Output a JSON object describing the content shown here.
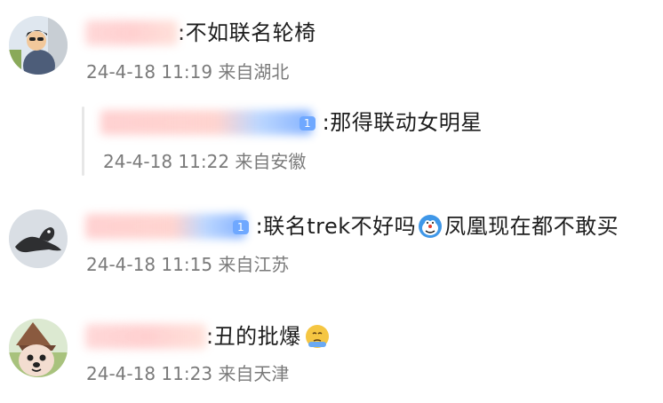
{
  "comments": [
    {
      "text": ":不如联名轮椅",
      "meta": "24-4-18 11:19 来自湖北"
    },
    {
      "text": ":那得联动女明星",
      "meta": "24-4-18 11:22 来自安徽"
    },
    {
      "text_before_emoji": ":联名trek不好吗",
      "text_after_emoji": "凤凰现在都不敢买",
      "meta": "24-4-18 11:15 来自江苏"
    },
    {
      "text": ":丑的批爆",
      "meta": "24-4-18 11:23 来自天津"
    }
  ],
  "badges": [
    "1",
    "1"
  ],
  "icons": {
    "comment1_avatar": "cartoon-man-avatar-icon",
    "comment3_avatar": "seal-avatar-icon",
    "comment3_emoji": "doraemon-emoji-icon",
    "comment4_avatar": "cartoon-dog-with-hat-avatar-icon",
    "comment4_emoji": "pensive-face-emoji-icon"
  },
  "colors": {
    "meta_gray": "#7a7a7a",
    "badge_blue": "#6fa8ff",
    "reply_bar": "#e7e7e7"
  }
}
